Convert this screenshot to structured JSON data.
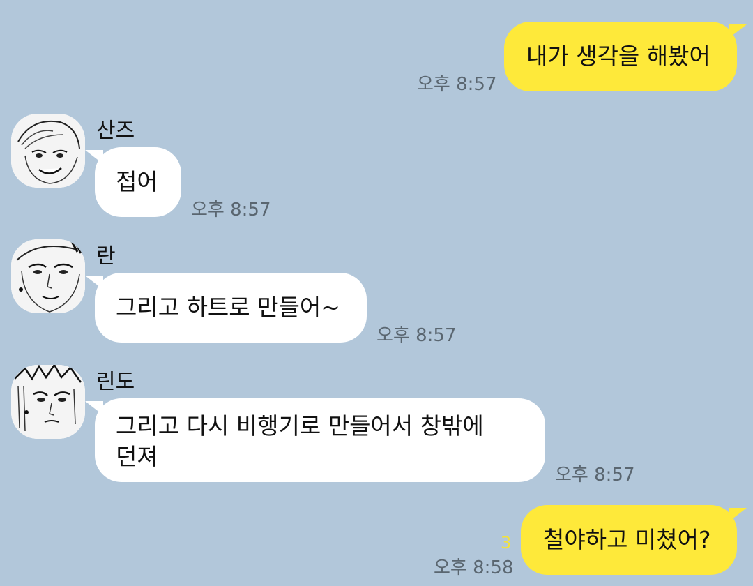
{
  "messages": [
    {
      "sender": "me",
      "text": "내가 생각을 해봤어",
      "time": "오후 8:57"
    },
    {
      "sender": "산즈",
      "text": "접어",
      "time": "오후 8:57"
    },
    {
      "sender": "란",
      "text": "그리고 하트로 만들어~",
      "time": "오후 8:57"
    },
    {
      "sender": "린도",
      "lines": [
        "그리고 다시 비행기로 만들어서 창밖에",
        "던져"
      ],
      "time": "오후 8:57"
    },
    {
      "sender": "me",
      "text": "철야하고 미쳤어?",
      "time": "오후 8:58",
      "unread": "3"
    }
  ],
  "colors": {
    "background": "#b2c7da",
    "my_bubble": "#fee93a",
    "their_bubble": "#ffffff",
    "timestamp": "#5a6670",
    "unread_count": "#f3e23a"
  },
  "avatars": [
    "manga-sketch-avatar-sanzu",
    "manga-sketch-avatar-ran",
    "manga-sketch-avatar-rindo"
  ]
}
